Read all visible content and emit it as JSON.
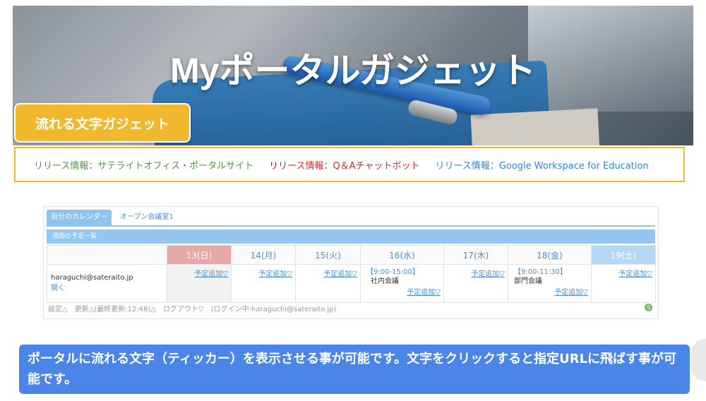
{
  "banner": {
    "title": "Myポータルガジェット",
    "badge": "流れる文字ガジェット"
  },
  "ticker": [
    {
      "text": "リリース情報：サテライトオフィス・ポータルサイト",
      "color": "#4b9d3a"
    },
    {
      "text": "リリース情報：Q＆Aチャットボット",
      "color": "#d92b23"
    },
    {
      "text": "リリース情報：Google Workspace for Education",
      "color": "#2f86d6"
    }
  ],
  "calendar": {
    "tabs": [
      "自分のカレンダー",
      "オープン会議室1"
    ],
    "week_label": "週間の予定一覧",
    "days": [
      "13(日)",
      "14(月)",
      "15(火)",
      "16(水)",
      "17(木)",
      "18(金)",
      "19(土)"
    ],
    "user": "haraguchi@sateraito.jp",
    "open_link": "開く",
    "add_label": "予定追加▽",
    "events": [
      {
        "day": "16(水)",
        "time": "【9:00-15:00】",
        "title": "社内会議"
      },
      {
        "day": "18(金)",
        "time": "【9:00-11:30】",
        "title": "部門会議"
      }
    ],
    "footer": "設定△　更新△(最終更新:12:46)△　ログアウト▽　(ログイン中:haraguchi@sateraito.jp)",
    "status_icon": "S"
  },
  "description": "ポータルに流れる文字（ティッカー）を表示させる事が可能です。文字をクリックすると指定URLに飛ばす事が可能です。"
}
